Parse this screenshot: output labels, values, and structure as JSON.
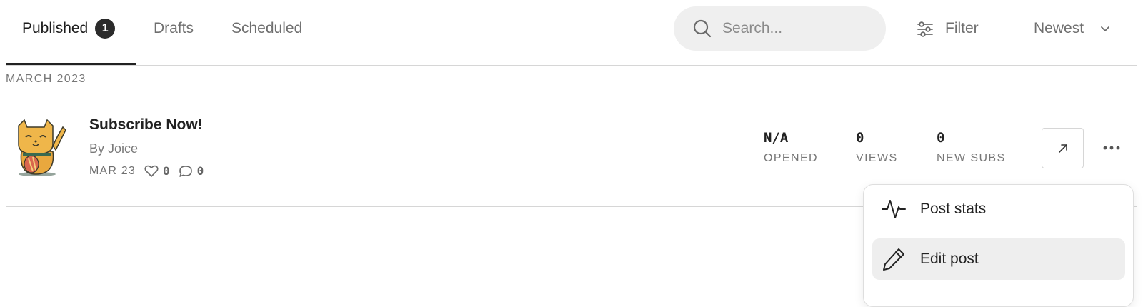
{
  "tabs": [
    {
      "label": "Published",
      "count": "1"
    },
    {
      "label": "Drafts"
    },
    {
      "label": "Scheduled"
    }
  ],
  "search": {
    "placeholder": "Search...",
    "value": ""
  },
  "filter": {
    "label": "Filter",
    "icon": "sliders-icon"
  },
  "sort": {
    "label": "Newest",
    "icon": "chevron-down-icon"
  },
  "section": {
    "heading": "MARCH 2023"
  },
  "post": {
    "title": "Subscribe Now!",
    "author": "By Joice",
    "date": "MAR 23",
    "likes": "0",
    "comments": "0",
    "thumbnail_icon": "lucky-cat-image",
    "stats": [
      {
        "value": "N/A",
        "label": "OPENED"
      },
      {
        "value": "0",
        "label": "VIEWS"
      },
      {
        "value": "0",
        "label": "NEW SUBS"
      }
    ]
  },
  "menu": {
    "items": [
      {
        "label": "Post stats",
        "icon": "activity-icon"
      },
      {
        "label": "Edit post",
        "icon": "pencil-icon"
      }
    ]
  },
  "colors": {
    "accent": "#222222",
    "badge_bg": "#2b2b2b",
    "search_bg": "#efefef",
    "menu_hover": "#eeeeee"
  }
}
